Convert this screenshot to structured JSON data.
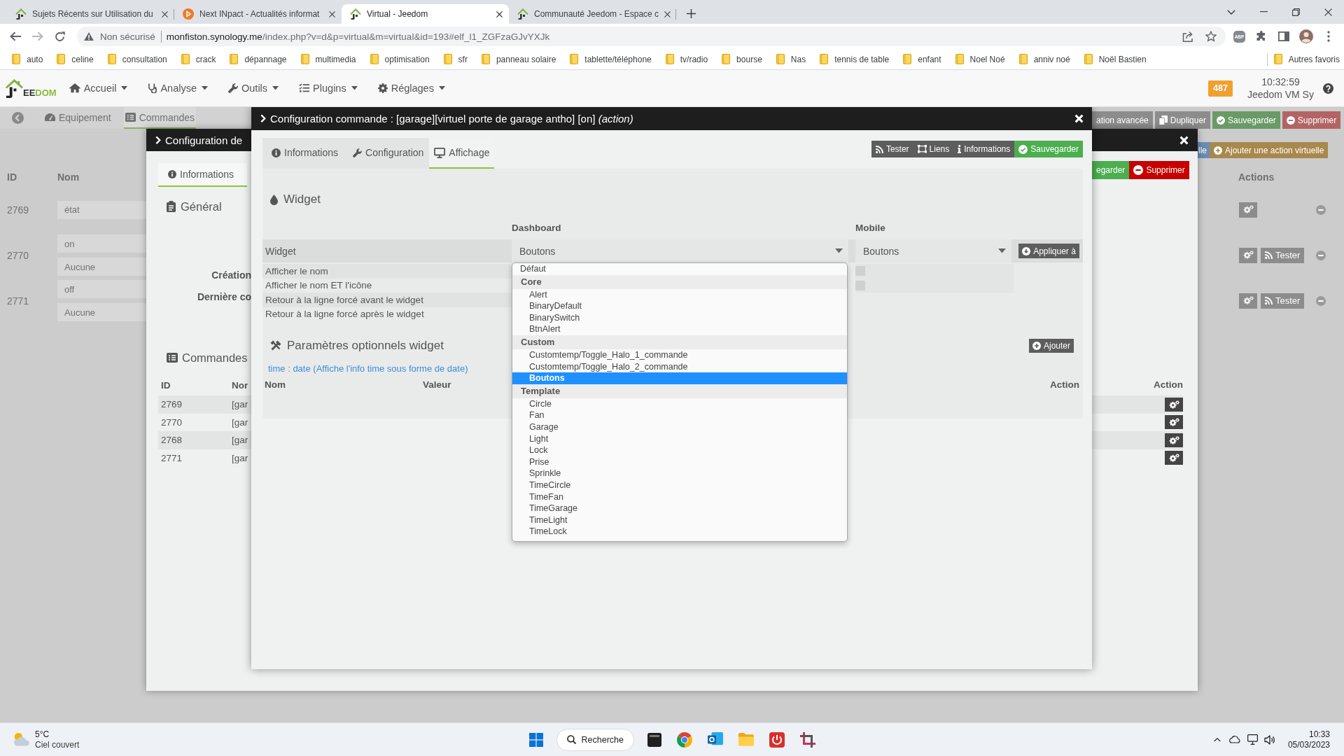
{
  "browser": {
    "tabs": [
      {
        "title": "Sujets Récents sur Utilisation du",
        "selected": false
      },
      {
        "title": "Next INpact - Actualités informat",
        "selected": false
      },
      {
        "title": "Virtual - Jeedom",
        "selected": true
      },
      {
        "title": "Communauté Jeedom - Espace c",
        "selected": false
      }
    ],
    "address": {
      "security": "Non sécurisé",
      "host": "monfiston.synology.me",
      "path": "/index.php?v=d&p=virtual&m=virtual&id=193#elf_l1_ZGFzaGJvYXJk"
    },
    "extension_badge": "ABP",
    "bookmarks": [
      "auto",
      "celine",
      "consultation",
      "crack",
      "dépannage",
      "multimedia",
      "optimisation",
      "sfr",
      "panneau solaire",
      "tablette/téléphone",
      "tv/radio",
      "bourse",
      "Nas",
      "tennis de table",
      "enfant",
      "Noel Noé",
      "anniv noé",
      "Noël Bastien"
    ],
    "other_bookmarks": "Autres favoris"
  },
  "navbar": {
    "logo": [
      {
        "text": "EE",
        "accent": false
      },
      {
        "text": "DOM",
        "accent": true
      }
    ],
    "menus": [
      "Accueil",
      "Analyse",
      "Outils",
      "Plugins",
      "Réglages"
    ],
    "badge": "487",
    "time": "10:32:59",
    "host": "Jeedom VM Sy"
  },
  "background_page": {
    "tabs": [
      {
        "label": "Equipement",
        "selected": false
      },
      {
        "label": "Commandes",
        "selected": true
      }
    ],
    "toolbar_buttons": [
      {
        "label": "ation avancée",
        "kind": "default"
      },
      {
        "label": "Dupliquer",
        "kind": "default"
      },
      {
        "label": "Sauvegarder",
        "kind": "success"
      },
      {
        "label": "Supprimer",
        "kind": "danger"
      }
    ],
    "add_buttons": [
      {
        "label": "lle",
        "kind": "info"
      },
      {
        "label": "Ajouter une action virtuelle",
        "kind": "warning"
      }
    ],
    "columns": [
      "ID",
      "Nom"
    ],
    "actions_header": "Actions",
    "rows": [
      {
        "id": "2769",
        "fields": [
          "état"
        ]
      },
      {
        "id": "2770",
        "fields": [
          "on",
          "Aucune"
        ],
        "test_button": "Tester"
      },
      {
        "id": "2771",
        "fields": [
          "off",
          "Aucune"
        ],
        "test_button": "Tester"
      }
    ]
  },
  "equipment_modal": {
    "title": "Configuration de",
    "tabs": [
      {
        "label": "Informations",
        "selected": true
      }
    ],
    "buttons": [
      {
        "label": "egarder",
        "kind": "success"
      },
      {
        "label": "Supprimer",
        "kind": "danger"
      }
    ],
    "general_heading": "Général",
    "field_labels": [
      "Création",
      "Dernière co"
    ],
    "commands_heading": "Commandes",
    "table": {
      "columns": [
        "ID",
        "Nor"
      ],
      "action_column": "Action",
      "rows": [
        {
          "id": "2769",
          "name": "[gar"
        },
        {
          "id": "2770",
          "name": "[gar"
        },
        {
          "id": "2768",
          "name": "[gar"
        },
        {
          "id": "2771",
          "name": "[gar"
        }
      ]
    }
  },
  "command_modal": {
    "title": "Configuration commande : [garage][virtuel porte de garage antho] [on] *(action)*",
    "tabs": [
      {
        "label": "Informations",
        "selected": false
      },
      {
        "label": "Configuration",
        "selected": false
      },
      {
        "label": "Affichage",
        "selected": true
      }
    ],
    "buttons": [
      {
        "label": "Tester",
        "kind": "default"
      },
      {
        "label": "Liens",
        "kind": "default"
      },
      {
        "label": "Informations",
        "kind": "default"
      },
      {
        "label": "Sauvegarder",
        "kind": "success"
      }
    ],
    "widget": {
      "heading": "Widget",
      "columns": [
        "Dashboard",
        "Mobile"
      ],
      "row_label": "Widget",
      "dashboard_value": "Boutons",
      "mobile_value": "Boutons",
      "apply_button": "Appliquer à",
      "options": [
        {
          "label": "Afficher le nom",
          "mobile_checked": false
        },
        {
          "label": "Afficher le nom ET l'icône",
          "mobile_checked": false
        },
        {
          "label": "Retour à la ligne forcé avant le widget"
        },
        {
          "label": "Retour à la ligne forcé après le widget"
        }
      ],
      "dropdown": {
        "items": [
          {
            "kind": "option",
            "label": "Défaut",
            "selected": false
          },
          {
            "kind": "group",
            "label": "Core",
            "options": [
              {
                "label": "Alert",
                "selected": false
              },
              {
                "label": "BinaryDefault",
                "selected": false
              },
              {
                "label": "BinarySwitch",
                "selected": false
              },
              {
                "label": "BtnAlert",
                "selected": false
              }
            ]
          },
          {
            "kind": "group",
            "label": "Custom",
            "options": [
              {
                "label": "Customtemp/Toggle_Halo_1_commande",
                "selected": false
              },
              {
                "label": "Customtemp/Toggle_Halo_2_commande",
                "selected": false
              },
              {
                "label": "Boutons",
                "selected": true
              }
            ]
          },
          {
            "kind": "group",
            "label": "Template",
            "options": [
              {
                "label": "Circle",
                "selected": false
              },
              {
                "label": "Fan",
                "selected": false
              },
              {
                "label": "Garage",
                "selected": false
              },
              {
                "label": "Light",
                "selected": false
              },
              {
                "label": "Lock",
                "selected": false
              },
              {
                "label": "Prise",
                "selected": false
              },
              {
                "label": "Sprinkle",
                "selected": false
              },
              {
                "label": "TimeCircle",
                "selected": false
              },
              {
                "label": "TimeFan",
                "selected": false
              },
              {
                "label": "TimeGarage",
                "selected": false
              },
              {
                "label": "TimeLight",
                "selected": false
              },
              {
                "label": "TimeLock",
                "selected": false
              }
            ]
          }
        ]
      }
    },
    "parameters": {
      "heading": "Paramètres optionnels widget",
      "add_button": "Ajouter",
      "hint": "time : date (Affiche l'info time sous forme de date)",
      "columns": [
        "Nom",
        "Valeur",
        "Action"
      ]
    }
  },
  "taskbar": {
    "weather": {
      "temperature": "5°C",
      "condition": "Ciel couvert"
    },
    "search_label": "Recherche",
    "clock": {
      "time": "10:33",
      "date": "05/03/2023"
    }
  }
}
